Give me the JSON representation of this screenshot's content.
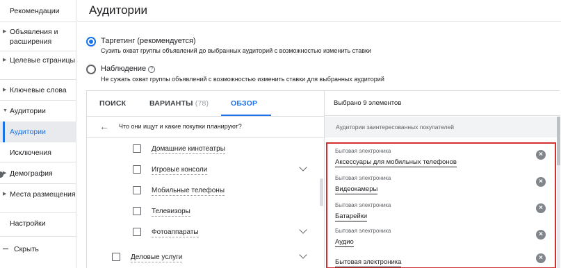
{
  "sidebar": {
    "items": [
      {
        "label": "Рекомендации"
      },
      {
        "label": "Объявления и расширения"
      },
      {
        "label": "Целевые страницы"
      },
      {
        "label": "Ключевые слова"
      },
      {
        "label": "Аудитории"
      },
      {
        "label": "Аудитории"
      },
      {
        "label": "Исключения"
      },
      {
        "label": "Демография"
      },
      {
        "label": "Места размещения"
      },
      {
        "label": "Настройки"
      }
    ],
    "hide_label": "Скрыть"
  },
  "header": {
    "title": "Аудитории"
  },
  "options": {
    "targeting": {
      "title": "Таргетинг (рекомендуется)",
      "desc": "Сузить охват группы объявлений до выбранных аудиторий с возможностью изменить ставки"
    },
    "observation": {
      "title": "Наблюдение",
      "desc": "Не сужать охват группы объявлений с возможностью изменить ставки для выбранных аудиторий"
    }
  },
  "tabs": {
    "search": "ПОИСК",
    "variants": "ВАРИАНТЫ",
    "variants_count": "(78)",
    "overview": "ОБЗОР"
  },
  "browse": {
    "back_text": "Что они ищут и какие покупки планируют?",
    "categories": [
      {
        "label": "Домашние кинотеатры"
      },
      {
        "label": "Игровые консоли"
      },
      {
        "label": "Мобильные телефоны"
      },
      {
        "label": "Телевизоры"
      },
      {
        "label": "Фотоаппараты"
      },
      {
        "label": "Деловые услуги"
      }
    ]
  },
  "selected": {
    "header": "Выбрано 9 элементов",
    "subheader": "Аудитории заинтересованных покупателей",
    "items": [
      {
        "category": "Бытовая электроника",
        "name": "Аксессуары для мобильных телефонов"
      },
      {
        "category": "Бытовая электроника",
        "name": "Видеокамеры"
      },
      {
        "category": "Бытовая электроника",
        "name": "Батарейки"
      },
      {
        "category": "Бытовая электроника",
        "name": "Аудио"
      },
      {
        "category": "",
        "name": "Бытовая электроника"
      }
    ]
  },
  "colors": {
    "accent": "#1a73e8",
    "highlight": "#d32f2f"
  }
}
